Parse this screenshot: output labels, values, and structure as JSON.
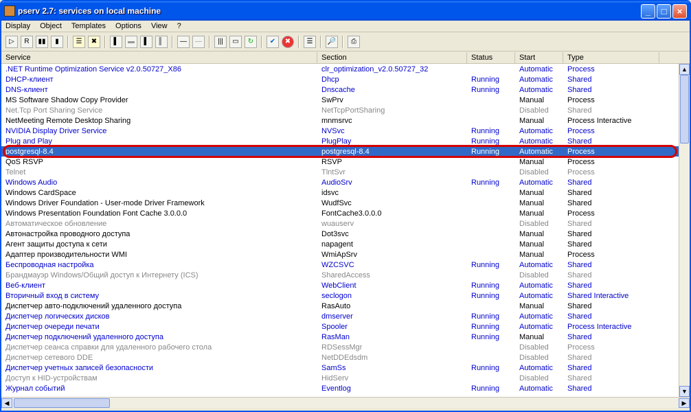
{
  "window": {
    "title": "pserv 2.7: services on local machine"
  },
  "menu": {
    "display": "Display",
    "object": "Object",
    "templates": "Templates",
    "options": "Options",
    "view": "View",
    "help": "?"
  },
  "columns": {
    "service": "Service",
    "section": "Section",
    "status": "Status",
    "start": "Start",
    "type": "Type"
  },
  "rows": [
    {
      "service": ".NET Runtime Optimization Service v2.0.50727_X86",
      "section": "clr_optimization_v2.0.50727_32",
      "status": "",
      "start": "Automatic",
      "start_style": "link",
      "type": "Process",
      "style": "link"
    },
    {
      "service": "DHCP-клиент",
      "section": "Dhcp",
      "status": "Running",
      "start": "Automatic",
      "start_style": "link",
      "type": "Shared",
      "style": "link"
    },
    {
      "service": "DNS-клиент",
      "section": "Dnscache",
      "status": "Running",
      "start": "Automatic",
      "start_style": "link",
      "type": "Shared",
      "style": "link"
    },
    {
      "service": "MS Software Shadow Copy Provider",
      "section": "SwPrv",
      "status": "",
      "start": "Manual",
      "start_style": "normal",
      "type": "Process",
      "style": "normal"
    },
    {
      "service": "Net.Tcp Port Sharing Service",
      "section": "NetTcpPortSharing",
      "status": "",
      "start": "Disabled",
      "start_style": "disabled",
      "type": "Shared",
      "style": "disabled"
    },
    {
      "service": "NetMeeting Remote Desktop Sharing",
      "section": "mnmsrvc",
      "status": "",
      "start": "Manual",
      "start_style": "normal",
      "type": "Process Interactive",
      "style": "normal"
    },
    {
      "service": "NVIDIA Display Driver Service",
      "section": "NVSvc",
      "status": "Running",
      "start": "Automatic",
      "start_style": "link",
      "type": "Process",
      "style": "link"
    },
    {
      "service": "Plug and Play",
      "section": "PlugPlay",
      "status": "Running",
      "start": "Automatic",
      "start_style": "link",
      "type": "Shared",
      "style": "link"
    },
    {
      "service": "postgresql-8.4",
      "section": "postgresql-8.4",
      "status": "Running",
      "start": "Automatic",
      "start_style": "link",
      "type": "Process",
      "style": "link",
      "selected": true,
      "highlighted": true
    },
    {
      "service": "QoS RSVP",
      "section": "RSVP",
      "status": "",
      "start": "Manual",
      "start_style": "normal",
      "type": "Process",
      "style": "normal"
    },
    {
      "service": "Telnet",
      "section": "TlntSvr",
      "status": "",
      "start": "Disabled",
      "start_style": "disabled",
      "type": "Process",
      "style": "disabled"
    },
    {
      "service": "Windows Audio",
      "section": "AudioSrv",
      "status": "Running",
      "start": "Automatic",
      "start_style": "link",
      "type": "Shared",
      "style": "link"
    },
    {
      "service": "Windows CardSpace",
      "section": "idsvc",
      "status": "",
      "start": "Manual",
      "start_style": "normal",
      "type": "Shared",
      "style": "normal"
    },
    {
      "service": "Windows Driver Foundation - User-mode Driver Framework",
      "section": "WudfSvc",
      "status": "",
      "start": "Manual",
      "start_style": "normal",
      "type": "Shared",
      "style": "normal"
    },
    {
      "service": "Windows Presentation Foundation Font Cache 3.0.0.0",
      "section": "FontCache3.0.0.0",
      "status": "",
      "start": "Manual",
      "start_style": "normal",
      "type": "Process",
      "style": "normal"
    },
    {
      "service": "Автоматическое обновление",
      "section": "wuauserv",
      "status": "",
      "start": "Disabled",
      "start_style": "disabled",
      "type": "Shared",
      "style": "disabled"
    },
    {
      "service": "Автонастройка проводного доступа",
      "section": "Dot3svc",
      "status": "",
      "start": "Manual",
      "start_style": "normal",
      "type": "Shared",
      "style": "normal"
    },
    {
      "service": "Агент защиты доступа к сети",
      "section": "napagent",
      "status": "",
      "start": "Manual",
      "start_style": "normal",
      "type": "Shared",
      "style": "normal"
    },
    {
      "service": "Адаптер производительности WMI",
      "section": "WmiApSrv",
      "status": "",
      "start": "Manual",
      "start_style": "normal",
      "type": "Process",
      "style": "normal"
    },
    {
      "service": "Беспроводная настройка",
      "section": "WZCSVC",
      "status": "Running",
      "start": "Automatic",
      "start_style": "link",
      "type": "Shared",
      "style": "link"
    },
    {
      "service": "Брандмауэр Windows/Общий доступ к Интернету (ICS)",
      "section": "SharedAccess",
      "status": "",
      "start": "Disabled",
      "start_style": "disabled",
      "type": "Shared",
      "style": "disabled"
    },
    {
      "service": "Веб-клиент",
      "section": "WebClient",
      "status": "Running",
      "start": "Automatic",
      "start_style": "link",
      "type": "Shared",
      "style": "link"
    },
    {
      "service": "Вторичный вход в систему",
      "section": "seclogon",
      "status": "Running",
      "start": "Automatic",
      "start_style": "link",
      "type": "Shared Interactive",
      "style": "link"
    },
    {
      "service": "Диспетчер авто-подключений удаленного доступа",
      "section": "RasAuto",
      "status": "",
      "start": "Manual",
      "start_style": "normal",
      "type": "Shared",
      "style": "normal"
    },
    {
      "service": "Диспетчер логических дисков",
      "section": "dmserver",
      "status": "Running",
      "start": "Automatic",
      "start_style": "link",
      "type": "Shared",
      "style": "link"
    },
    {
      "service": "Диспетчер очереди печати",
      "section": "Spooler",
      "status": "Running",
      "start": "Automatic",
      "start_style": "link",
      "type": "Process Interactive",
      "style": "link"
    },
    {
      "service": "Диспетчер подключений удаленного доступа",
      "section": "RasMan",
      "status": "Running",
      "start": "Manual",
      "start_style": "normal",
      "type": "Shared",
      "style": "link"
    },
    {
      "service": "Диспетчер сеанса справки для удаленного рабочего стола",
      "section": "RDSessMgr",
      "status": "",
      "start": "Disabled",
      "start_style": "disabled",
      "type": "Process",
      "style": "disabled"
    },
    {
      "service": "Диспетчер сетевого DDE",
      "section": "NetDDEdsdm",
      "status": "",
      "start": "Disabled",
      "start_style": "disabled",
      "type": "Shared",
      "style": "disabled"
    },
    {
      "service": "Диспетчер учетных записей безопасности",
      "section": "SamSs",
      "status": "Running",
      "start": "Automatic",
      "start_style": "link",
      "type": "Shared",
      "style": "link"
    },
    {
      "service": "Доступ к HID-устройствам",
      "section": "HidServ",
      "status": "",
      "start": "Disabled",
      "start_style": "disabled",
      "type": "Shared",
      "style": "disabled"
    },
    {
      "service": "Журнал событий",
      "section": "Eventlog",
      "status": "Running",
      "start": "Automatic",
      "start_style": "link",
      "type": "Shared",
      "style": "link"
    }
  ]
}
